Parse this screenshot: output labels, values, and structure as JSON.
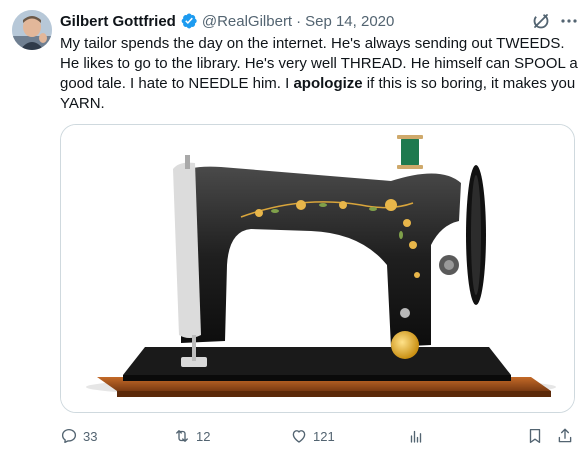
{
  "tweet": {
    "author_name": "Gilbert Gottfried",
    "handle": "@RealGilbert",
    "separator": "·",
    "date": "Sep 14, 2020",
    "text_before_bold": "My tailor spends the day on the internet. He's always sending out TWEEDS. He likes to go to the library. He's very well THREAD. He himself can SPOOL a good tale. I hate to NEEDLE him. I ",
    "text_bold": "apologize",
    "text_after_bold": " if this is so boring, it makes you YARN."
  },
  "icons": {
    "verified": "verified-badge-icon",
    "grok": "grok-icon",
    "more": "more-icon",
    "reply": "reply-icon",
    "retweet": "retweet-icon",
    "like": "heart-icon",
    "views": "views-icon",
    "bookmark": "bookmark-icon",
    "share": "share-icon"
  },
  "actions": {
    "replies": "33",
    "retweets": "12",
    "likes": "121"
  },
  "colors": {
    "verified_blue": "#1d9bf0",
    "secondary_text": "#536471",
    "primary_text": "#0f1419"
  }
}
